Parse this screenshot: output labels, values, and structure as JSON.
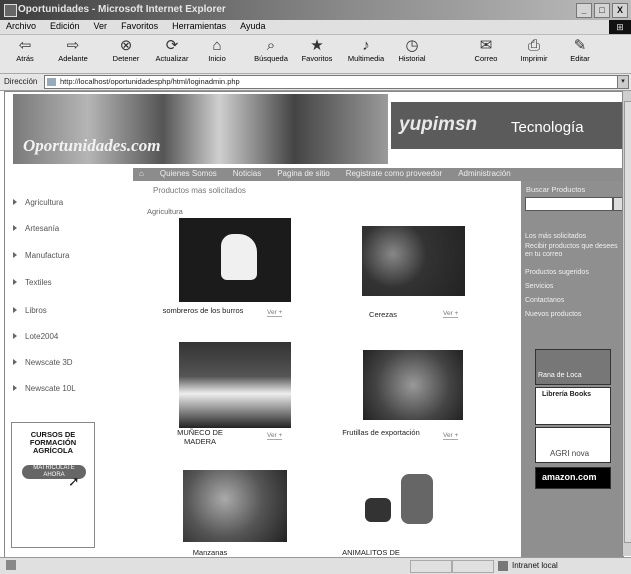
{
  "window": {
    "title": "Oportunidades - Microsoft Internet Explorer",
    "buttons": [
      "_",
      "□",
      "X"
    ]
  },
  "menu": [
    "Archivo",
    "Edición",
    "Ver",
    "Favoritos",
    "Herramientas",
    "Ayuda"
  ],
  "toolbar": [
    {
      "icon": "back-arrow-icon",
      "label": "Atrás"
    },
    {
      "icon": "forward-arrow-icon",
      "label": "Adelante"
    },
    {
      "icon": "stop-icon",
      "label": "Detener"
    },
    {
      "icon": "refresh-icon",
      "label": "Actualizar"
    },
    {
      "icon": "home-icon",
      "label": "Inicio"
    },
    {
      "icon": "search-icon",
      "label": "Búsqueda"
    },
    {
      "icon": "favorites-icon",
      "label": "Favoritos"
    },
    {
      "icon": "multimedia-icon",
      "label": "Multimedia"
    },
    {
      "icon": "history-icon",
      "label": "Historial"
    },
    {
      "icon": "mail-icon",
      "label": "Correo"
    },
    {
      "icon": "print-icon",
      "label": "Imprimir"
    },
    {
      "icon": "edit-icon",
      "label": "Editar"
    }
  ],
  "address": {
    "label": "Dirección",
    "url": "http://localhost/oportunidadesphp/html/loginadmin.php"
  },
  "banner": {
    "brand": "Oportunidades.com",
    "partner": "yupimsn",
    "section": "Tecnología"
  },
  "nav": [
    "Quienes Somos",
    "Noticias",
    "Pagina de sitio",
    "Registrate como proveedor",
    "Administración"
  ],
  "sidebar": [
    "Agricultura",
    "Artesanía",
    "Manufactura",
    "Textiles",
    "Libros",
    "Lote2004",
    "Newscate 3D",
    "Newscate 10L"
  ],
  "course": {
    "title": "CURSOS DE FORMACIÓN AGRÍCOLA",
    "button": "MATRICULATE AHORA"
  },
  "center": {
    "heading": "Productos mas solicitados",
    "category": "Agricultura",
    "products": [
      {
        "name": "sombreros de los burros",
        "more": "Ver +"
      },
      {
        "name": "Cerezas",
        "more": "Ver +"
      },
      {
        "name": "MUÑECO DE MADERA",
        "more": "Ver +"
      },
      {
        "name": "Frutillas de exportación",
        "more": "Ver +"
      },
      {
        "name": "Manzanas",
        "more": ""
      },
      {
        "name": "ANIMALITOS DE",
        "more": ""
      }
    ]
  },
  "right": {
    "search_label": "Buscar Productos",
    "links": [
      "Los más solicitados",
      "Recibir productos que desees en tu correo",
      "Productos sugeridos",
      "Servicios",
      "Contactanos",
      "Nuevos productos"
    ],
    "ads": [
      "Rana de Loca",
      "Librería Books",
      "AGRI nova",
      "amazon.com"
    ]
  },
  "status": {
    "zone": "Intranet local"
  }
}
